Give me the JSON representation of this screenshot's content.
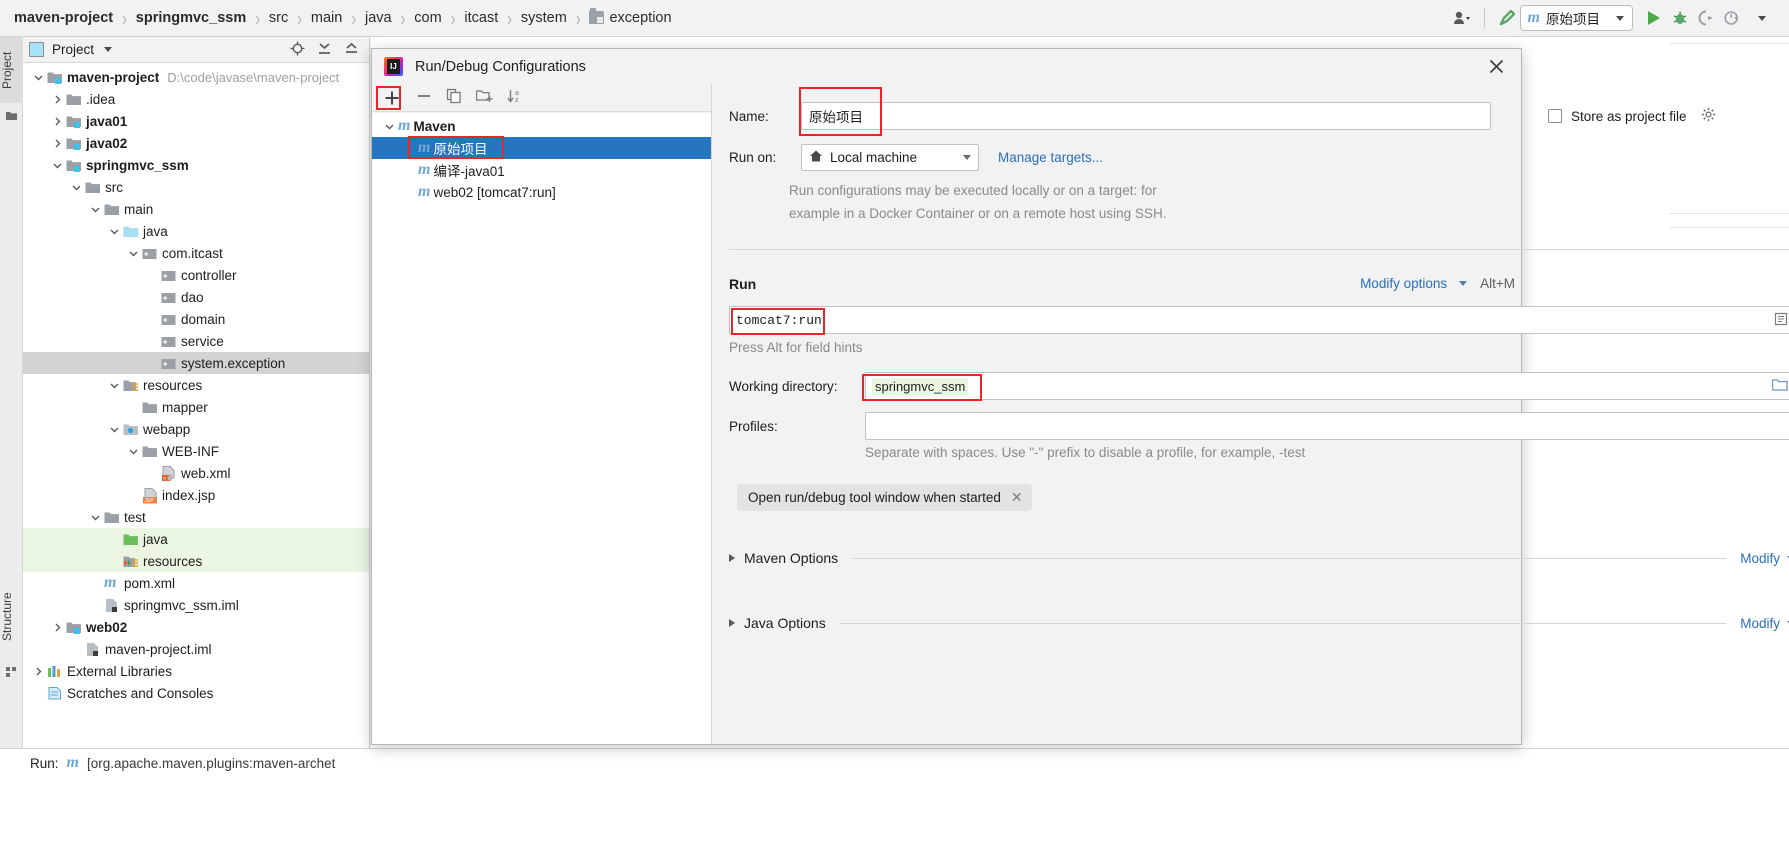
{
  "breadcrumb": {
    "items": [
      {
        "label": "maven-project",
        "bold": true
      },
      {
        "label": "springmvc_ssm",
        "bold": true
      },
      {
        "label": "src",
        "bold": false
      },
      {
        "label": "main",
        "bold": false
      },
      {
        "label": "java",
        "bold": false
      },
      {
        "label": "com",
        "bold": false
      },
      {
        "label": "itcast",
        "bold": false
      },
      {
        "label": "system",
        "bold": false
      },
      {
        "label": "exception",
        "bold": false,
        "icon": "folder-icon"
      }
    ],
    "separator": "›"
  },
  "toolbar": {
    "profile_icon": "user-icon",
    "build_icon": "hammer-icon",
    "run_config_name": "原始项目",
    "run_config_icon": "maven-m-icon",
    "dropdown_icon": "chevron-down-icon",
    "run_icon": "run-play-icon",
    "debug_icon": "debug-bug-icon",
    "run_with_coverage_icon": "run-coverage-icon",
    "profiler_icon": "profiler-icon",
    "more_icon": "chevron-down-icon"
  },
  "left_strip": {
    "tabs": [
      "Project",
      "Structure",
      "Bookmarks"
    ]
  },
  "project_panel": {
    "title": "Project",
    "title_icon": "project-view-icon",
    "dropdown_icon": "chevron-down-icon",
    "header_icons": [
      "locate-target-icon",
      "expand-all-icon",
      "collapse-all-icon"
    ],
    "tree": [
      {
        "depth": 0,
        "twisty": "down",
        "icon": "module-folder",
        "label": "maven-project",
        "bold": true,
        "path": "D:\\code\\javase\\maven-project",
        "state": "none"
      },
      {
        "depth": 1,
        "twisty": "right",
        "icon": "folder",
        "label": ".idea",
        "bold": false,
        "state": "none"
      },
      {
        "depth": 1,
        "twisty": "right",
        "icon": "module-folder",
        "label": "java01",
        "bold": true,
        "state": "none"
      },
      {
        "depth": 1,
        "twisty": "right",
        "icon": "module-folder",
        "label": "java02",
        "bold": true,
        "state": "none"
      },
      {
        "depth": 1,
        "twisty": "down",
        "icon": "module-folder",
        "label": "springmvc_ssm",
        "bold": true,
        "state": "none"
      },
      {
        "depth": 2,
        "twisty": "down",
        "icon": "folder",
        "label": "src",
        "bold": false,
        "state": "none"
      },
      {
        "depth": 3,
        "twisty": "down",
        "icon": "folder",
        "label": "main",
        "bold": false,
        "state": "none"
      },
      {
        "depth": 4,
        "twisty": "down",
        "icon": "source-folder",
        "label": "java",
        "bold": false,
        "state": "none"
      },
      {
        "depth": 5,
        "twisty": "down",
        "icon": "package",
        "label": "com.itcast",
        "bold": false,
        "state": "none"
      },
      {
        "depth": 6,
        "twisty": "none",
        "icon": "package",
        "label": "controller",
        "bold": false,
        "state": "none"
      },
      {
        "depth": 6,
        "twisty": "none",
        "icon": "package",
        "label": "dao",
        "bold": false,
        "state": "none"
      },
      {
        "depth": 6,
        "twisty": "none",
        "icon": "package",
        "label": "domain",
        "bold": false,
        "state": "none"
      },
      {
        "depth": 6,
        "twisty": "none",
        "icon": "package",
        "label": "service",
        "bold": false,
        "state": "none"
      },
      {
        "depth": 6,
        "twisty": "none",
        "icon": "package",
        "label": "system.exception",
        "bold": false,
        "state": "gray"
      },
      {
        "depth": 4,
        "twisty": "down",
        "icon": "resource-folder",
        "label": "resources",
        "bold": false,
        "state": "none"
      },
      {
        "depth": 5,
        "twisty": "none",
        "icon": "folder",
        "label": "mapper",
        "bold": false,
        "state": "none"
      },
      {
        "depth": 4,
        "twisty": "down",
        "icon": "webapp-folder",
        "label": "webapp",
        "bold": false,
        "state": "none"
      },
      {
        "depth": 5,
        "twisty": "down",
        "icon": "folder",
        "label": "WEB-INF",
        "bold": false,
        "state": "none"
      },
      {
        "depth": 6,
        "twisty": "none",
        "icon": "xml-file",
        "label": "web.xml",
        "bold": false,
        "state": "none"
      },
      {
        "depth": 5,
        "twisty": "none",
        "icon": "jsp-file",
        "label": "index.jsp",
        "bold": false,
        "state": "none"
      },
      {
        "depth": 3,
        "twisty": "down",
        "icon": "folder",
        "label": "test",
        "bold": false,
        "state": "none"
      },
      {
        "depth": 4,
        "twisty": "none",
        "icon": "test-source-folder",
        "label": "java",
        "bold": false,
        "state": "green"
      },
      {
        "depth": 4,
        "twisty": "none",
        "icon": "test-resource-folder",
        "label": "resources",
        "bold": false,
        "state": "green"
      },
      {
        "depth": 3,
        "twisty": "none",
        "icon": "maven-m-icon",
        "label": "pom.xml",
        "bold": false,
        "state": "none"
      },
      {
        "depth": 3,
        "twisty": "none",
        "icon": "iml-file",
        "label": "springmvc_ssm.iml",
        "bold": false,
        "state": "none"
      },
      {
        "depth": 1,
        "twisty": "right",
        "icon": "module-folder",
        "label": "web02",
        "bold": true,
        "state": "none"
      },
      {
        "depth": 2,
        "twisty": "none",
        "icon": "iml-file",
        "label": "maven-project.iml",
        "bold": false,
        "state": "none"
      },
      {
        "depth": 0,
        "twisty": "right",
        "icon": "libraries",
        "label": "External Libraries",
        "bold": false,
        "state": "none"
      },
      {
        "depth": 0,
        "twisty": "none",
        "icon": "scratches",
        "label": "Scratches and Consoles",
        "bold": false,
        "state": "none"
      }
    ]
  },
  "dialog": {
    "title": "Run/Debug Configurations",
    "title_icon": "intellij-idea-icon",
    "close_icon": "close-icon",
    "left_toolbar": [
      {
        "name": "add-configuration-button",
        "icon": "plus-icon",
        "highlighted": true
      },
      {
        "name": "remove-configuration-button",
        "icon": "minus-icon",
        "highlighted": false
      },
      {
        "name": "copy-configuration-button",
        "icon": "copy-icon",
        "highlighted": false
      },
      {
        "name": "move-to-folder-button",
        "icon": "new-folder-icon",
        "highlighted": false
      },
      {
        "name": "sort-configurations-button",
        "icon": "sort-az-icon",
        "highlighted": false
      }
    ],
    "config_tree": [
      {
        "depth": 0,
        "twisty": "down",
        "icon": "maven-m-icon",
        "label": "Maven",
        "bold": true,
        "selected": false,
        "highlighted": false
      },
      {
        "depth": 1,
        "twisty": "none",
        "icon": "maven-m-icon",
        "label": "原始项目",
        "bold": false,
        "selected": true,
        "highlighted": true
      },
      {
        "depth": 1,
        "twisty": "none",
        "icon": "maven-m-icon",
        "label": "编译-java01",
        "bold": false,
        "selected": false,
        "highlighted": false
      },
      {
        "depth": 1,
        "twisty": "none",
        "icon": "maven-m-icon",
        "label": "web02 [tomcat7:run]",
        "bold": false,
        "selected": false,
        "highlighted": false
      }
    ],
    "form": {
      "name_label": "Name:",
      "name_value": "原始项目",
      "store_as_project_file_label": "Store as project file",
      "store_as_project_file_checked": false,
      "store_gear_icon": "gear-icon",
      "run_on_label": "Run on:",
      "run_on_value": "Local machine",
      "run_on_icon": "home-icon",
      "manage_targets_link": "Manage targets...",
      "run_on_hint_line1": "Run configurations may be executed locally or on a target: for",
      "run_on_hint_line2": "example in a Docker Container or on a remote host using SSH.",
      "run_section_title": "Run",
      "modify_options_label": "Modify options",
      "modify_options_shortcut": "Alt+M",
      "command_value": "tomcat7:run",
      "command_expand_icon": "expand-editor-icon",
      "command_hint": "Press Alt for field hints",
      "working_directory_label": "Working directory:",
      "working_directory_value": "springmvc_ssm",
      "working_directory_browse_icon": "folder-browse-icon",
      "profiles_label": "Profiles:",
      "profiles_value": "",
      "profiles_hint": "Separate with spaces. Use \"-\" prefix to disable a profile, for example, -test",
      "chip_label": "Open run/debug tool window when started",
      "chip_close_icon": "close-small-icon",
      "maven_options_label": "Maven Options",
      "maven_options_modify": "Modify",
      "java_options_label": "Java Options",
      "java_options_modify": "Modify"
    }
  },
  "bottom": {
    "run_label": "Run:",
    "run_icon": "maven-m-icon",
    "run_command": "[org.apache.maven.plugins:maven-archet"
  },
  "colors": {
    "accent_blue": "#2675bf",
    "highlight_red": "#e8262a",
    "link_blue": "#2b6fba",
    "selection_gray": "#d3d3d3",
    "test_green": "#eaf5e2"
  }
}
